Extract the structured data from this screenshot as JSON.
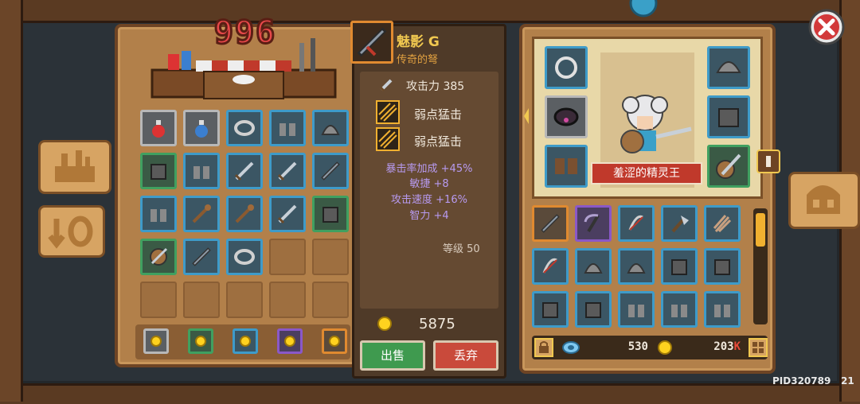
{
  "shop": {
    "counter": "996",
    "slot_rows": [
      [
        "grey",
        "grey",
        "blue",
        "blue",
        "blue"
      ],
      [
        "green",
        "blue",
        "blue",
        "blue",
        "blue"
      ],
      [
        "blue",
        "blue",
        "blue",
        "blue",
        "green"
      ],
      [
        "green",
        "blue",
        "blue",
        "empty",
        "empty"
      ],
      [
        "empty",
        "empty",
        "empty",
        "empty",
        "empty"
      ]
    ],
    "slot_icons": [
      [
        "potion-red-icon",
        "potion-blue-icon",
        "ring-icon",
        "boots-icon",
        "helmet-icon"
      ],
      [
        "armor-icon",
        "boots-icon",
        "sword-icon",
        "sword-icon",
        "crossbow-icon"
      ],
      [
        "boots-icon",
        "staff-icon",
        "staff-icon",
        "sword-icon",
        "armor-icon"
      ],
      [
        "shield-icon",
        "crossbow-icon",
        "ring-icon",
        "",
        ""
      ],
      [
        "",
        "",
        "",
        "",
        ""
      ]
    ],
    "filter_colors": [
      "grey",
      "green",
      "blue",
      "purple",
      "orange"
    ]
  },
  "tooltip": {
    "name": "魅影 G",
    "subtitle": "传奇的弩",
    "attack_label": "攻击力 385",
    "skills": [
      "弱点猛击",
      "弱点猛击"
    ],
    "stats": [
      "暴击率加成 +45%",
      "敏捷 +8",
      "攻击速度 +16%",
      "智力 +4"
    ],
    "level": "等级 50",
    "price": "5875",
    "sell_label": "出售",
    "discard_label": "丢弃"
  },
  "hero": {
    "name": "羞涩的精灵王",
    "gem_count": "530",
    "gold_count": "203",
    "gold_suffix": "K",
    "inventory_colors": [
      [
        "orange",
        "purple",
        "blue",
        "blue",
        "blue"
      ],
      [
        "blue",
        "blue",
        "blue",
        "blue",
        "blue"
      ],
      [
        "blue",
        "blue",
        "blue",
        "blue",
        "blue"
      ]
    ],
    "inventory_icons": [
      [
        "crossbow-icon",
        "scythe-icon",
        "bow-icon",
        "axe-icon",
        "claw-icon"
      ],
      [
        "bow-icon",
        "helmet-icon",
        "helmet-icon",
        "armor-icon",
        "armor-icon"
      ],
      [
        "armor-icon",
        "armor-icon",
        "boots-icon",
        "boots-icon",
        "boots-icon"
      ]
    ]
  },
  "footer": {
    "pid": "PID320789",
    "num": "21"
  },
  "colors": {
    "gold": "#ffd21f",
    "panel": "#b2804a",
    "tooltip_bg": "#4f3a28",
    "stat_purple": "#b79af0",
    "sell": "#3f9a4f",
    "discard": "#c94a3b"
  }
}
